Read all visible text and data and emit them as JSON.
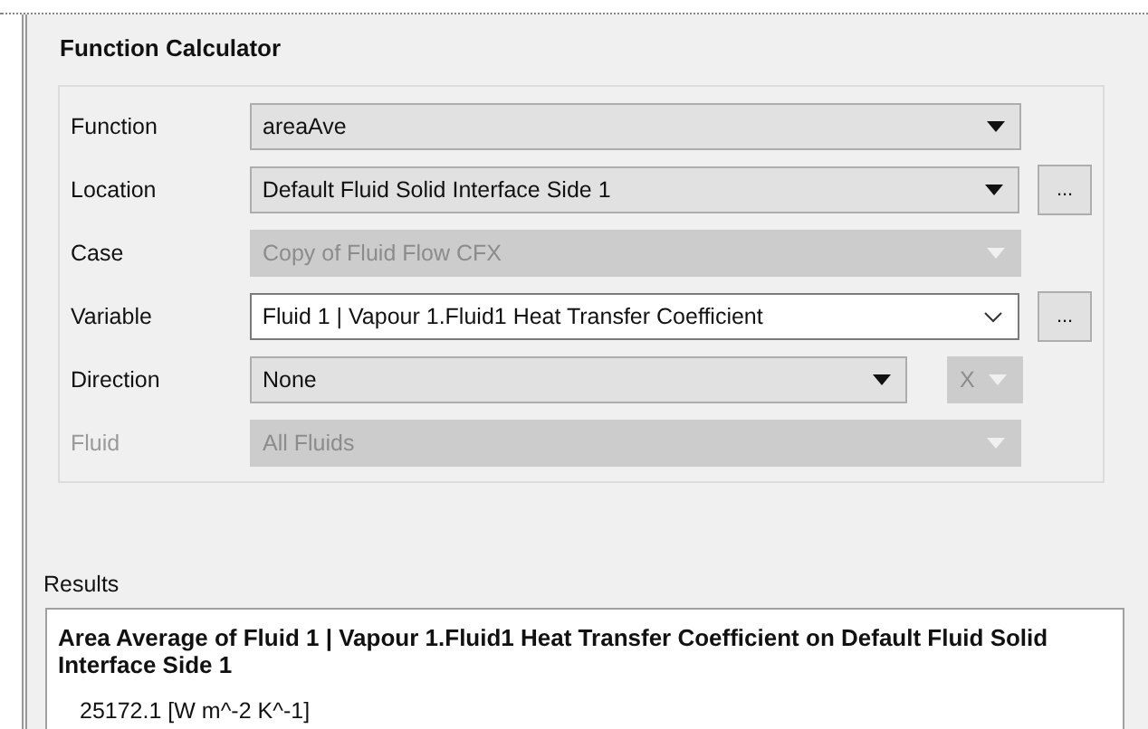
{
  "panel": {
    "title": "Function Calculator"
  },
  "rows": [
    {
      "label": "Function",
      "label_disabled": false,
      "kind": "dropdown",
      "value": "areaAve",
      "disabled": false
    },
    {
      "label": "Location",
      "label_disabled": false,
      "kind": "dropdown",
      "value": "Default Fluid Solid Interface Side 1",
      "disabled": false,
      "browse": "..."
    },
    {
      "label": "Case",
      "label_disabled": false,
      "kind": "dropdown",
      "value": "Copy of Fluid Flow CFX",
      "disabled": true
    },
    {
      "label": "Variable",
      "label_disabled": false,
      "kind": "editable",
      "value": "Fluid 1 | Vapour 1.Fluid1 Heat Transfer Coefficient",
      "disabled": false,
      "browse": "..."
    },
    {
      "label": "Direction",
      "label_disabled": false,
      "kind": "dropdown",
      "value": "None",
      "disabled": false,
      "extra": {
        "value": "X",
        "disabled": true
      }
    },
    {
      "label": "Fluid",
      "label_disabled": true,
      "kind": "dropdown",
      "value": "All Fluids",
      "disabled": true
    }
  ],
  "results": {
    "label": "Results",
    "heading": "Area Average of Fluid 1 | Vapour 1.Fluid1 Heat Transfer Coefficient on Default Fluid Solid Interface Side 1",
    "value": "25172.1 [W m^-2 K^-1]"
  }
}
